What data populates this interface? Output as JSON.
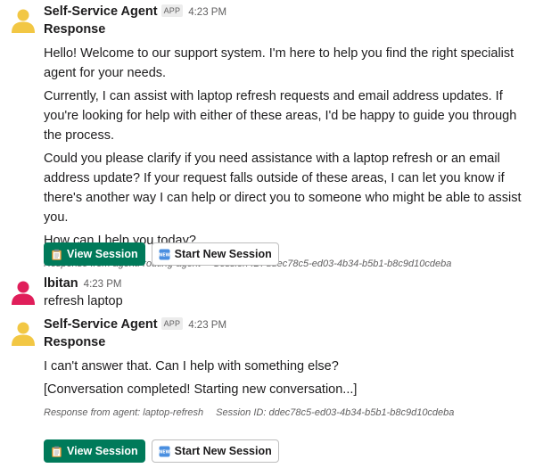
{
  "messages": [
    {
      "sender": "Self-Service Agent",
      "badge": "APP",
      "time": "4:23 PM",
      "title": "Response",
      "paragraphs": [
        "Hello! Welcome to our support system. I'm here to help you find the right specialist agent for your needs.",
        "Currently, I can assist with laptop refresh requests and email address updates. If you're looking for help with either of these areas, I'd be happy to guide you through the process.",
        "Could you please clarify if you need assistance with a laptop refresh or an email address update? If your request falls outside of these areas, I can let you know if there's another way I can help or direct you to someone who might be able to assist you.",
        "How can I help you today?"
      ],
      "agent_line": "Response from agent: routing-agent",
      "session_line": "Session ID: ddec78c5-ed03-4b34-b5b1-b8c9d10cdeba",
      "view_button": "View Session",
      "new_button": "Start New Session"
    },
    {
      "sender": "lbitan",
      "time": "4:23 PM",
      "text": "refresh laptop"
    },
    {
      "sender": "Self-Service Agent",
      "badge": "APP",
      "time": "4:23 PM",
      "title": "Response",
      "paragraphs": [
        "I can't answer that. Can I help with something else?",
        "[Conversation completed! Starting new conversation...]"
      ],
      "agent_line": "Response from agent: laptop-refresh",
      "session_line": "Session ID: ddec78c5-ed03-4b34-b5b1-b8c9d10cdeba",
      "view_button": "View Session",
      "new_button": "Start New Session"
    }
  ],
  "icons": {
    "bot_avatar": "person-avatar-yellow",
    "user_avatar": "person-avatar-red",
    "view_icon": "clipboard-icon",
    "new_icon": "new-badge-icon"
  },
  "colors": {
    "bot_avatar": "#f2c744",
    "user_avatar": "#e01e5a",
    "primary_button": "#007a5a"
  }
}
